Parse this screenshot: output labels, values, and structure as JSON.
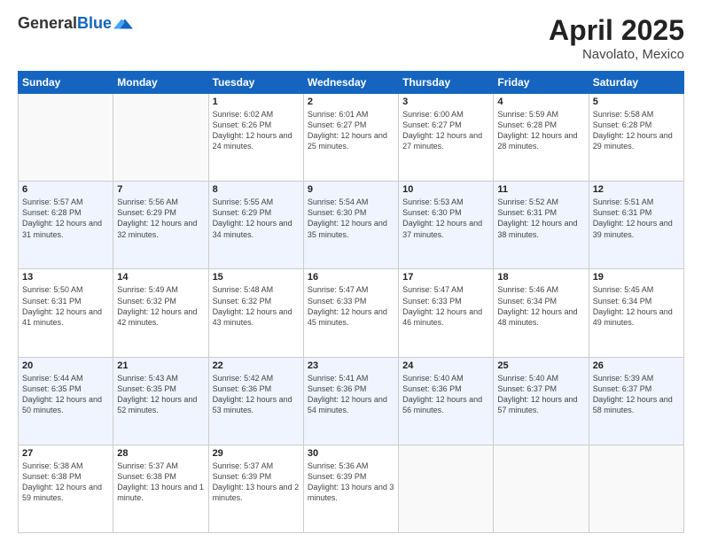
{
  "header": {
    "logo_general": "General",
    "logo_blue": "Blue",
    "title": "April 2025",
    "location": "Navolato, Mexico"
  },
  "days_of_week": [
    "Sunday",
    "Monday",
    "Tuesday",
    "Wednesday",
    "Thursday",
    "Friday",
    "Saturday"
  ],
  "weeks": [
    [
      {
        "day": "",
        "info": ""
      },
      {
        "day": "",
        "info": ""
      },
      {
        "day": "1",
        "info": "Sunrise: 6:02 AM\nSunset: 6:26 PM\nDaylight: 12 hours and 24 minutes."
      },
      {
        "day": "2",
        "info": "Sunrise: 6:01 AM\nSunset: 6:27 PM\nDaylight: 12 hours and 25 minutes."
      },
      {
        "day": "3",
        "info": "Sunrise: 6:00 AM\nSunset: 6:27 PM\nDaylight: 12 hours and 27 minutes."
      },
      {
        "day": "4",
        "info": "Sunrise: 5:59 AM\nSunset: 6:28 PM\nDaylight: 12 hours and 28 minutes."
      },
      {
        "day": "5",
        "info": "Sunrise: 5:58 AM\nSunset: 6:28 PM\nDaylight: 12 hours and 29 minutes."
      }
    ],
    [
      {
        "day": "6",
        "info": "Sunrise: 5:57 AM\nSunset: 6:28 PM\nDaylight: 12 hours and 31 minutes."
      },
      {
        "day": "7",
        "info": "Sunrise: 5:56 AM\nSunset: 6:29 PM\nDaylight: 12 hours and 32 minutes."
      },
      {
        "day": "8",
        "info": "Sunrise: 5:55 AM\nSunset: 6:29 PM\nDaylight: 12 hours and 34 minutes."
      },
      {
        "day": "9",
        "info": "Sunrise: 5:54 AM\nSunset: 6:30 PM\nDaylight: 12 hours and 35 minutes."
      },
      {
        "day": "10",
        "info": "Sunrise: 5:53 AM\nSunset: 6:30 PM\nDaylight: 12 hours and 37 minutes."
      },
      {
        "day": "11",
        "info": "Sunrise: 5:52 AM\nSunset: 6:31 PM\nDaylight: 12 hours and 38 minutes."
      },
      {
        "day": "12",
        "info": "Sunrise: 5:51 AM\nSunset: 6:31 PM\nDaylight: 12 hours and 39 minutes."
      }
    ],
    [
      {
        "day": "13",
        "info": "Sunrise: 5:50 AM\nSunset: 6:31 PM\nDaylight: 12 hours and 41 minutes."
      },
      {
        "day": "14",
        "info": "Sunrise: 5:49 AM\nSunset: 6:32 PM\nDaylight: 12 hours and 42 minutes."
      },
      {
        "day": "15",
        "info": "Sunrise: 5:48 AM\nSunset: 6:32 PM\nDaylight: 12 hours and 43 minutes."
      },
      {
        "day": "16",
        "info": "Sunrise: 5:47 AM\nSunset: 6:33 PM\nDaylight: 12 hours and 45 minutes."
      },
      {
        "day": "17",
        "info": "Sunrise: 5:47 AM\nSunset: 6:33 PM\nDaylight: 12 hours and 46 minutes."
      },
      {
        "day": "18",
        "info": "Sunrise: 5:46 AM\nSunset: 6:34 PM\nDaylight: 12 hours and 48 minutes."
      },
      {
        "day": "19",
        "info": "Sunrise: 5:45 AM\nSunset: 6:34 PM\nDaylight: 12 hours and 49 minutes."
      }
    ],
    [
      {
        "day": "20",
        "info": "Sunrise: 5:44 AM\nSunset: 6:35 PM\nDaylight: 12 hours and 50 minutes."
      },
      {
        "day": "21",
        "info": "Sunrise: 5:43 AM\nSunset: 6:35 PM\nDaylight: 12 hours and 52 minutes."
      },
      {
        "day": "22",
        "info": "Sunrise: 5:42 AM\nSunset: 6:36 PM\nDaylight: 12 hours and 53 minutes."
      },
      {
        "day": "23",
        "info": "Sunrise: 5:41 AM\nSunset: 6:36 PM\nDaylight: 12 hours and 54 minutes."
      },
      {
        "day": "24",
        "info": "Sunrise: 5:40 AM\nSunset: 6:36 PM\nDaylight: 12 hours and 56 minutes."
      },
      {
        "day": "25",
        "info": "Sunrise: 5:40 AM\nSunset: 6:37 PM\nDaylight: 12 hours and 57 minutes."
      },
      {
        "day": "26",
        "info": "Sunrise: 5:39 AM\nSunset: 6:37 PM\nDaylight: 12 hours and 58 minutes."
      }
    ],
    [
      {
        "day": "27",
        "info": "Sunrise: 5:38 AM\nSunset: 6:38 PM\nDaylight: 12 hours and 59 minutes."
      },
      {
        "day": "28",
        "info": "Sunrise: 5:37 AM\nSunset: 6:38 PM\nDaylight: 13 hours and 1 minute."
      },
      {
        "day": "29",
        "info": "Sunrise: 5:37 AM\nSunset: 6:39 PM\nDaylight: 13 hours and 2 minutes."
      },
      {
        "day": "30",
        "info": "Sunrise: 5:36 AM\nSunset: 6:39 PM\nDaylight: 13 hours and 3 minutes."
      },
      {
        "day": "",
        "info": ""
      },
      {
        "day": "",
        "info": ""
      },
      {
        "day": "",
        "info": ""
      }
    ]
  ]
}
